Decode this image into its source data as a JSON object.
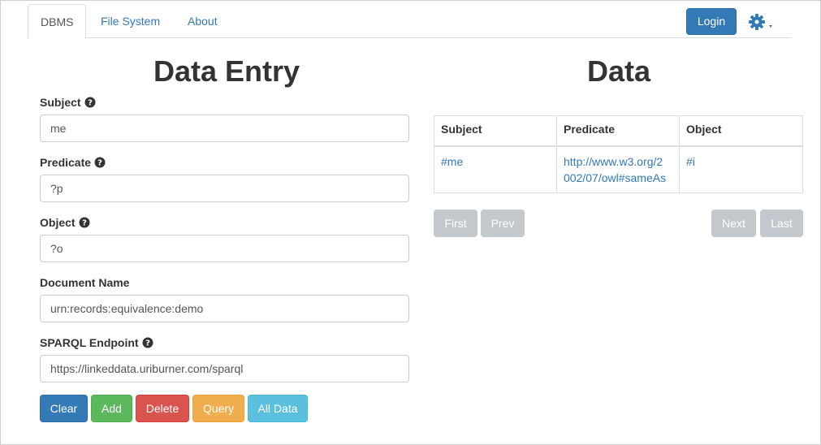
{
  "nav": {
    "tabs": [
      "DBMS",
      "File System",
      "About"
    ],
    "login_label": "Login"
  },
  "entry": {
    "title": "Data Entry",
    "fields": [
      {
        "label": "Subject",
        "value": "me",
        "help": true
      },
      {
        "label": "Predicate",
        "value": "?p",
        "help": true
      },
      {
        "label": "Object",
        "value": "?o",
        "help": true
      },
      {
        "label": "Document Name",
        "value": "urn:records:equivalence:demo",
        "help": false
      },
      {
        "label": "SPARQL Endpoint",
        "value": "https://linkeddata.uriburner.com/sparql",
        "help": true
      }
    ],
    "buttons": [
      {
        "label": "Clear",
        "color": "#337ab7"
      },
      {
        "label": "Add",
        "color": "#5cb85c"
      },
      {
        "label": "Delete",
        "color": "#d9534f"
      },
      {
        "label": "Query",
        "color": "#f0ad4e"
      },
      {
        "label": "All Data",
        "color": "#5bc0de"
      }
    ]
  },
  "data": {
    "title": "Data",
    "columns": [
      "Subject",
      "Predicate",
      "Object"
    ],
    "rows": [
      [
        "#me",
        "http://www.w3.org/2002/07/owl#sameAs",
        "#i"
      ]
    ],
    "predicate_line1": "http://www.w3.org/2",
    "predicate_line2": "002/07/owl#sameAs",
    "pager": {
      "first": "First",
      "prev": "Prev",
      "next": "Next",
      "last": "Last"
    }
  }
}
